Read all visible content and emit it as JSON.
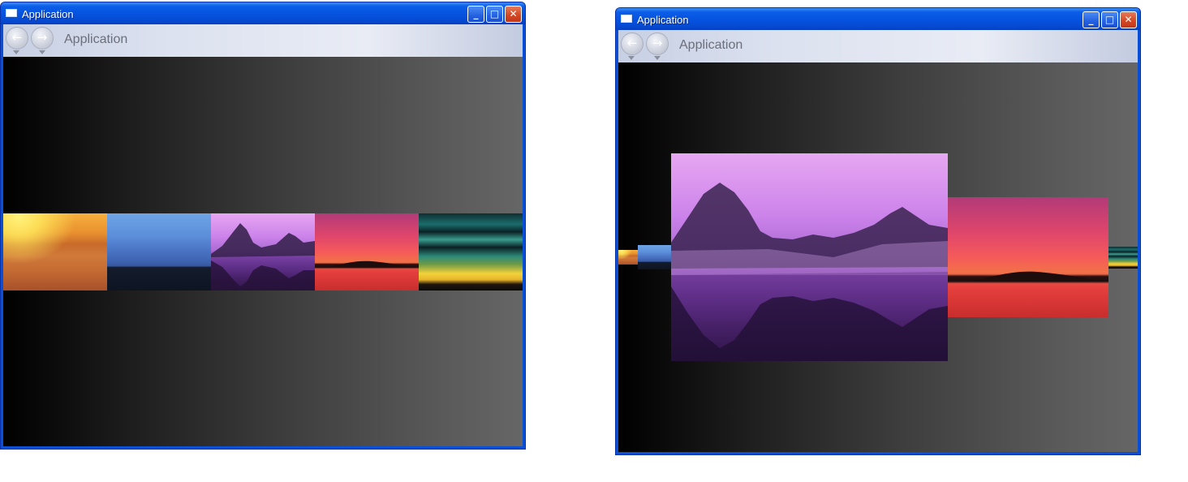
{
  "windows": [
    {
      "title": "Application",
      "nav_title": "Application",
      "caption_buttons": {
        "minimize": "_",
        "maximize": "□",
        "close": "✕"
      },
      "nav_icons": {
        "back": "←",
        "forward": "→"
      },
      "view": "filmstrip",
      "pictures": [
        "desert",
        "blue-hills",
        "purple-mountain-lake",
        "red-sunset-island",
        "teal-aurora-sky"
      ]
    },
    {
      "title": "Application",
      "nav_title": "Application",
      "caption_buttons": {
        "minimize": "_",
        "maximize": "□",
        "close": "✕"
      },
      "nav_icons": {
        "back": "←",
        "forward": "→"
      },
      "view": "coverflow",
      "selected_picture": "purple-mountain-lake",
      "pictures": [
        "desert",
        "blue-hills",
        "purple-mountain-lake",
        "red-sunset-island",
        "teal-aurora-sky"
      ]
    }
  ],
  "colors": {
    "titlebar": "#0552df",
    "frame": "#0a4fd6",
    "navbar": "#dbe1ef",
    "content_dark": "#000000",
    "content_light": "#666666"
  }
}
